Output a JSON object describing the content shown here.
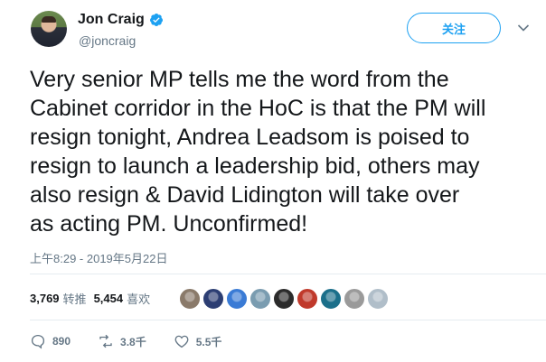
{
  "author": {
    "name": "Jon Craig",
    "handle": "@joncraig",
    "verified_icon": "verified-badge-icon"
  },
  "follow_button": {
    "label": "关注"
  },
  "tweet": {
    "text": "Very senior MP tells me the word from the\nCabinet corridor in the HoC is that the PM will\nresign tonight, Andrea Leadsom is poised to\nresign to launch a leadership bid, others may\nalso resign & David Lidington will take over\nas acting PM. Unconfirmed!",
    "timestamp": "上午8:29 - 2019年5月22日"
  },
  "stats": {
    "retweets": {
      "count": "3,769",
      "label": "转推"
    },
    "likes": {
      "count": "5,454",
      "label": "喜欢"
    }
  },
  "liker_avatars": [
    {
      "name": "liker-avatar-1",
      "color": "#8a7a6a"
    },
    {
      "name": "liker-avatar-2",
      "color": "#2c3e73"
    },
    {
      "name": "liker-avatar-3",
      "color": "#3a7bd5"
    },
    {
      "name": "liker-avatar-4",
      "color": "#7a9cb0"
    },
    {
      "name": "liker-avatar-5",
      "color": "#2b2b2b"
    },
    {
      "name": "liker-avatar-6",
      "color": "#c0392b"
    },
    {
      "name": "liker-avatar-7",
      "color": "#1b6f8a"
    },
    {
      "name": "liker-avatar-8",
      "color": "#9a9a9a"
    },
    {
      "name": "liker-avatar-9",
      "color": "#b0bec9"
    }
  ],
  "actions": {
    "reply": {
      "count": "890",
      "icon": "reply-icon"
    },
    "retweet": {
      "count": "3.8千",
      "icon": "retweet-icon"
    },
    "like": {
      "count": "5.5千",
      "icon": "heart-icon"
    }
  },
  "colors": {
    "accent": "#1da1f2",
    "secondary_text": "#657786"
  }
}
